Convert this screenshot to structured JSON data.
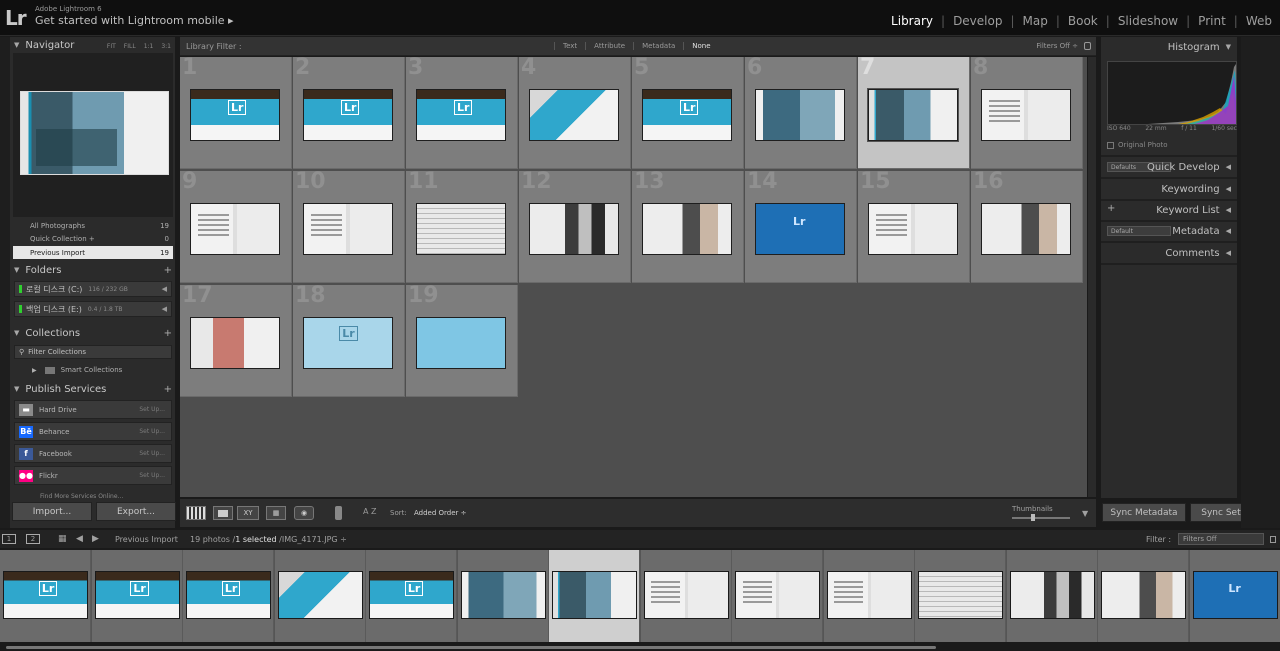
{
  "app": {
    "small_title": "Adobe Lightroom 6",
    "subtitle": "Get started with Lightroom mobile",
    "subtitle_arrow": "▸",
    "logo": "Lr"
  },
  "modules": [
    {
      "label": "Library",
      "active": true
    },
    {
      "label": "Develop",
      "active": false
    },
    {
      "label": "Map",
      "active": false
    },
    {
      "label": "Book",
      "active": false
    },
    {
      "label": "Slideshow",
      "active": false
    },
    {
      "label": "Print",
      "active": false
    },
    {
      "label": "Web",
      "active": false
    }
  ],
  "navigator": {
    "title": "Navigator",
    "options": [
      "FIT",
      "FILL",
      "1:1",
      "3:1"
    ]
  },
  "catalog": [
    {
      "label": "All Photographs",
      "count": "19"
    },
    {
      "label": "Quick Collection  +",
      "count": "0"
    },
    {
      "label": "Previous Import",
      "count": "19",
      "selected": true
    }
  ],
  "folders": {
    "title": "Folders",
    "disks": [
      {
        "name": "로컬 디스크 (C:)",
        "size": "116 / 232 GB"
      },
      {
        "name": "백업 디스크 (E:)",
        "size": "0.4 / 1.8 TB"
      }
    ]
  },
  "collections": {
    "title": "Collections",
    "filter_label": "Filter Collections",
    "smart_label": "Smart Collections"
  },
  "publish": {
    "title": "Publish Services",
    "services": [
      {
        "name": "Hard Drive",
        "setup": "Set Up...",
        "icon": "hard-drive-icon",
        "glyph": "▬",
        "color": "#8a8a8a"
      },
      {
        "name": "Behance",
        "setup": "Set Up...",
        "icon": "behance-icon",
        "glyph": "Bē",
        "color": "#1769ff"
      },
      {
        "name": "Facebook",
        "setup": "Set Up...",
        "icon": "facebook-icon",
        "glyph": "f",
        "color": "#3b5998"
      },
      {
        "name": "Flickr",
        "setup": "Set Up...",
        "icon": "flickr-icon",
        "glyph": "●●",
        "color": "#ff0084"
      }
    ],
    "more": "Find More Services Online..."
  },
  "left_buttons": {
    "import": "Import...",
    "export": "Export..."
  },
  "filter_bar": {
    "title": "Library Filter :",
    "options": [
      {
        "label": "Text",
        "active": false
      },
      {
        "label": "Attribute",
        "active": false
      },
      {
        "label": "Metadata",
        "active": false
      },
      {
        "label": "None",
        "active": true
      }
    ],
    "status": "Filters Off ÷"
  },
  "grid": {
    "columns": 8,
    "selected_index": 7,
    "items": [
      {
        "num": "1",
        "style": "t-cover"
      },
      {
        "num": "2",
        "style": "t-cover"
      },
      {
        "num": "3",
        "style": "t-cover"
      },
      {
        "num": "4",
        "style": "t-cover2"
      },
      {
        "num": "5",
        "style": "t-cover"
      },
      {
        "num": "6",
        "style": "t-water"
      },
      {
        "num": "7",
        "style": "t-photo"
      },
      {
        "num": "8",
        "style": "t-spread"
      },
      {
        "num": "9",
        "style": "t-spread"
      },
      {
        "num": "10",
        "style": "t-spread"
      },
      {
        "num": "11",
        "style": "t-text"
      },
      {
        "num": "12",
        "style": "t-mosaic"
      },
      {
        "num": "13",
        "style": "t-faces"
      },
      {
        "num": "14",
        "style": "t-blue"
      },
      {
        "num": "15",
        "style": "t-spread"
      },
      {
        "num": "16",
        "style": "t-faces"
      },
      {
        "num": "17",
        "style": "t-tablet"
      },
      {
        "num": "18",
        "style": "t-lightblue"
      },
      {
        "num": "19",
        "style": "t-pale"
      }
    ]
  },
  "toolbar": {
    "sort_label": "Sort:",
    "sort_value": "Added Order ÷",
    "thumbnails_label": "Thumbnails",
    "xy_label": "XY",
    "az_label": "A Z"
  },
  "right_panel": {
    "histogram_title": "Histogram",
    "iso": "ISO 640",
    "focal": "22 mm",
    "aperture": "f / 11",
    "shutter": "1/60 sec",
    "original_photo": "Original Photo",
    "preset_defaults": "Defaults",
    "quick_develop": "Quick Develop",
    "keywording": "Keywording",
    "keyword_list": "Keyword List",
    "metadata_preset": "Default",
    "metadata": "Metadata",
    "comments": "Comments",
    "sync_metadata": "Sync Metadata",
    "sync_settings": "Sync Settings"
  },
  "filmstrip": {
    "monitor1": "1",
    "monitor2": "2",
    "source": "Previous Import",
    "count_prefix": "19 photos /",
    "count_selected": "1 selected",
    "count_file": "/IMG_4171.JPG ÷",
    "filter_label": "Filter :",
    "filter_value": "Filters Off",
    "selected_index": 6,
    "items": [
      "t-cover",
      "t-cover",
      "t-cover",
      "t-cover2",
      "t-cover",
      "t-water",
      "t-photo",
      "t-spread",
      "t-spread",
      "t-spread",
      "t-text",
      "t-mosaic",
      "t-faces",
      "t-blue"
    ]
  },
  "colors": {
    "selected_cell": "#c4c4c4",
    "grid_cell": "#7d7d7d",
    "active_module": "#ffffff"
  }
}
